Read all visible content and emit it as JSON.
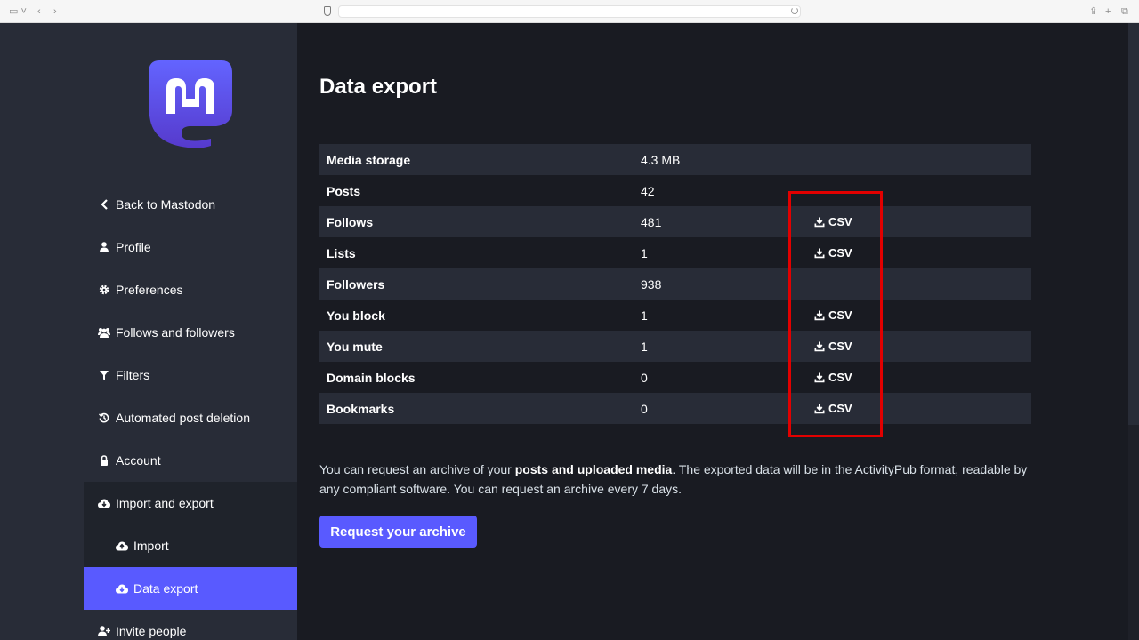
{
  "page": {
    "title": "Data export"
  },
  "sidebar": {
    "items": [
      {
        "label": "Back to Mastodon",
        "icon": "chevron-left-icon"
      },
      {
        "label": "Profile",
        "icon": "user-icon"
      },
      {
        "label": "Preferences",
        "icon": "gear-icon"
      },
      {
        "label": "Follows and followers",
        "icon": "users-icon"
      },
      {
        "label": "Filters",
        "icon": "filter-icon"
      },
      {
        "label": "Automated post deletion",
        "icon": "history-icon"
      },
      {
        "label": "Account",
        "icon": "lock-icon"
      },
      {
        "label": "Import and export",
        "icon": "cloud-download-icon"
      },
      {
        "label": "Import",
        "icon": "cloud-upload-icon"
      },
      {
        "label": "Data export",
        "icon": "cloud-download-icon"
      },
      {
        "label": "Invite people",
        "icon": "user-plus-icon"
      }
    ],
    "active": "Data export"
  },
  "export_table": {
    "csv_label": "CSV",
    "rows": [
      {
        "label": "Media storage",
        "value": "4.3 MB",
        "csv": false
      },
      {
        "label": "Posts",
        "value": "42",
        "csv": false
      },
      {
        "label": "Follows",
        "value": "481",
        "csv": true
      },
      {
        "label": "Lists",
        "value": "1",
        "csv": true
      },
      {
        "label": "Followers",
        "value": "938",
        "csv": false
      },
      {
        "label": "You block",
        "value": "1",
        "csv": true
      },
      {
        "label": "You mute",
        "value": "1",
        "csv": true
      },
      {
        "label": "Domain blocks",
        "value": "0",
        "csv": true
      },
      {
        "label": "Bookmarks",
        "value": "0",
        "csv": true
      }
    ]
  },
  "hint": {
    "before": "You can request an archive of your ",
    "bold": "posts and uploaded media",
    "after": ". The exported data will be in the ActivityPub format, readable by any compliant software. You can request an archive every 7 days."
  },
  "request_button": {
    "label": "Request your archive"
  },
  "colors": {
    "accent": "#595aff",
    "sidebar_bg": "#282c37",
    "main_bg": "#191b22",
    "highlight": "#e20000"
  }
}
